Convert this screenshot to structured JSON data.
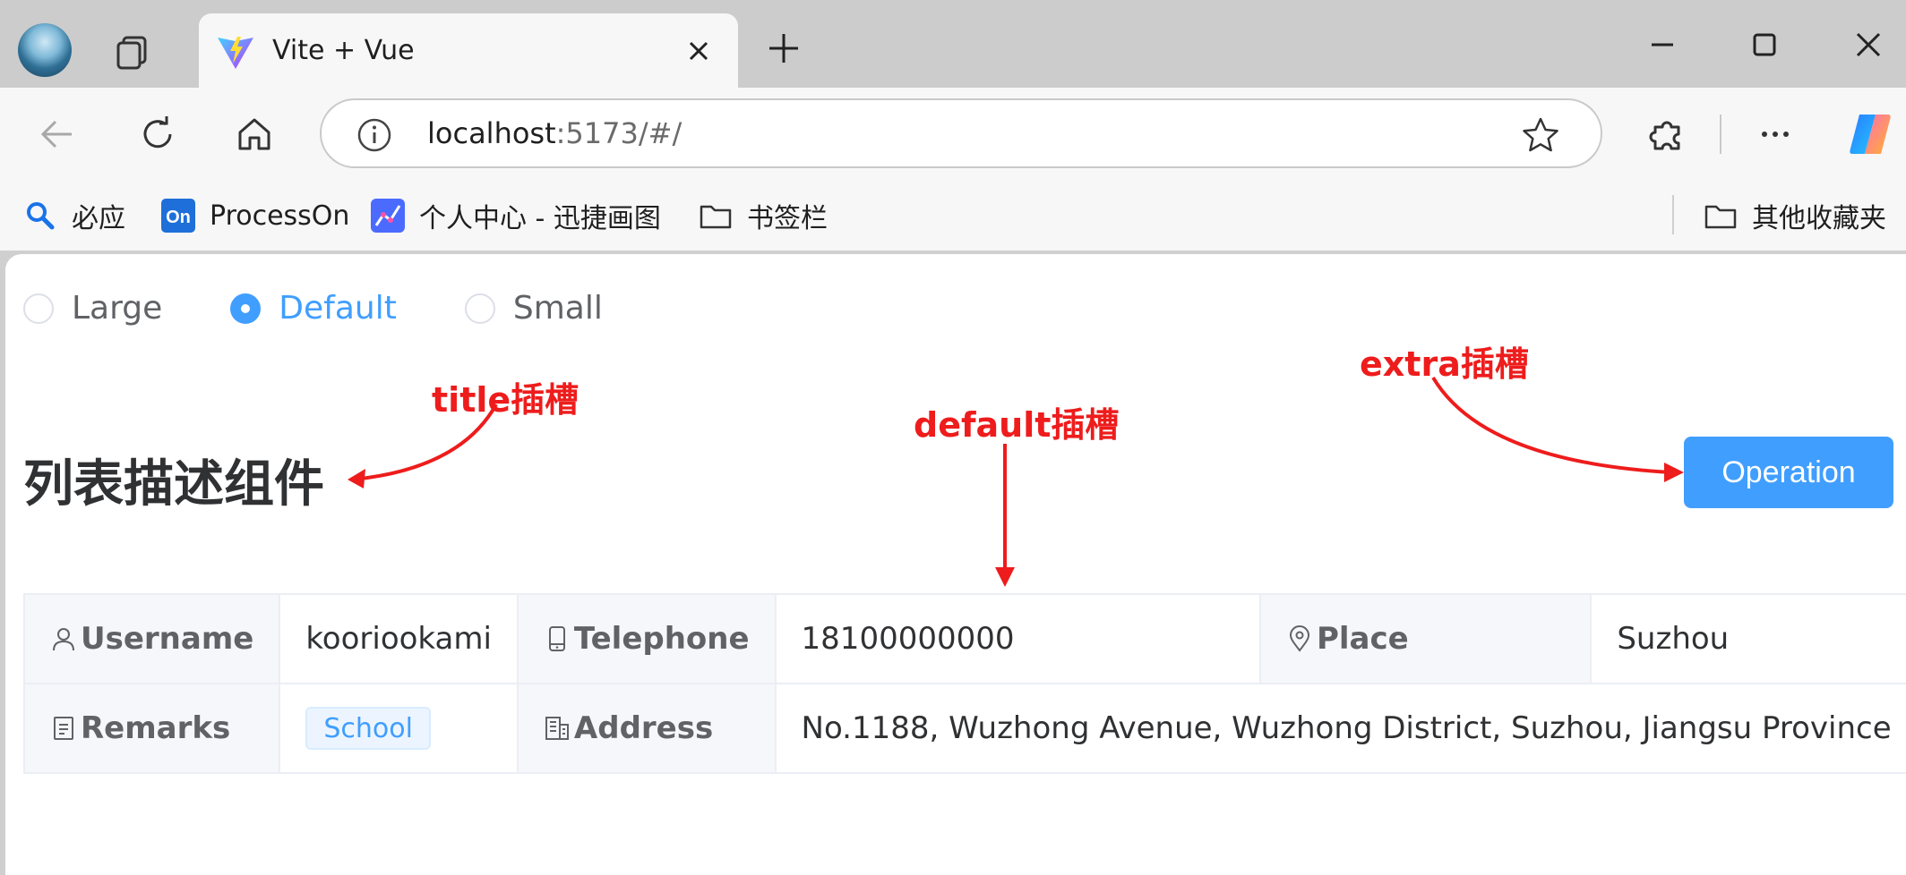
{
  "browser": {
    "tab_title": "Vite + Vue",
    "url_host": "localhost",
    "url_rest": ":5173/#/",
    "bookmarks": [
      {
        "label": "必应",
        "icon": "bing-search-icon"
      },
      {
        "label": "ProcessOn",
        "icon": "processon-logo-icon"
      },
      {
        "label": "个人中心 - 迅捷画图",
        "icon": "xunjie-chart-icon"
      },
      {
        "label": "书签栏",
        "icon": "folder-icon"
      }
    ],
    "other_bookmarks": "其他收藏夹",
    "colors": {
      "brand_processon": "#1e6fd9",
      "frame": "#cccccc",
      "toolbar": "#f7f7f7"
    }
  },
  "page": {
    "size_options": [
      {
        "label": "Large",
        "checked": false
      },
      {
        "label": "Default",
        "checked": true
      },
      {
        "label": "Small",
        "checked": false
      }
    ],
    "title": "列表描述组件",
    "operation_label": "Operation",
    "annotations": {
      "title_slot": "title插槽",
      "default_slot": "default插槽",
      "extra_slot": "extra插槽"
    },
    "descriptions": {
      "row1": [
        {
          "label": "Username",
          "icon": "user-icon",
          "value": "kooriookami"
        },
        {
          "label": "Telephone",
          "icon": "iphone-icon",
          "value": "18100000000"
        },
        {
          "label": "Place",
          "icon": "location-icon",
          "value": "Suzhou"
        }
      ],
      "row2": [
        {
          "label": "Remarks",
          "icon": "tickets-icon",
          "tag": "School"
        },
        {
          "label": "Address",
          "icon": "office-building-icon",
          "value": "No.1188, Wuzhong Avenue, Wuzhong District, Suzhou, Jiangsu Province"
        }
      ]
    },
    "colors": {
      "primary": "#409eff",
      "annotation": "#ee1c1c",
      "label_bg": "#f5f7fa",
      "border": "#ebeef5"
    }
  }
}
